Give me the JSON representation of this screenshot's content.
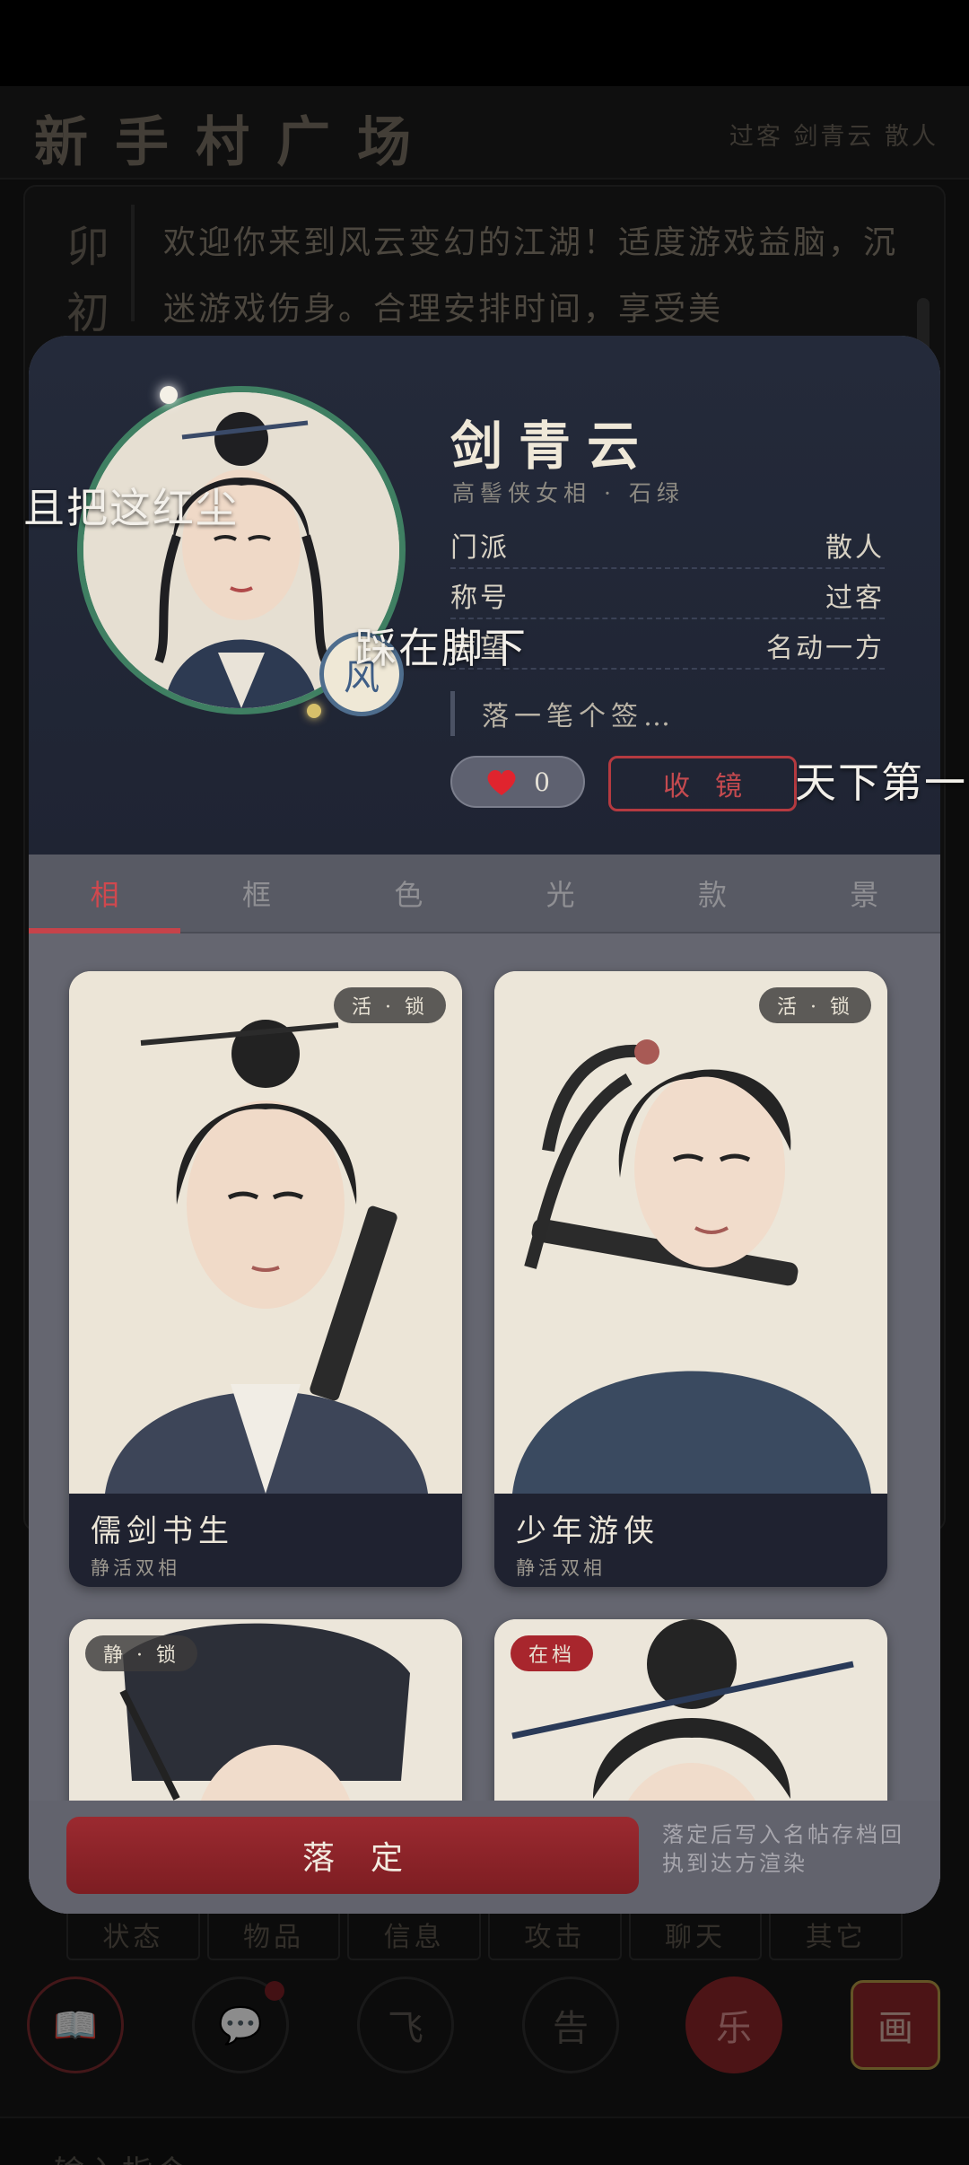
{
  "game": {
    "title": "新手村广场",
    "user_info": "过客 剑青云  散人",
    "notice_side": "卯初",
    "notice_text": "欢迎你来到风云变幻的江湖！适度游戏益脑，沉迷游戏伤身。合理安排时间，享受美",
    "commands": [
      "状态",
      "物品",
      "信息",
      "攻击",
      "聊天",
      "其它"
    ],
    "bottom_buttons": [
      {
        "icon": "book-icon",
        "glyph": "📖"
      },
      {
        "icon": "chat-icon",
        "glyph": "💬"
      },
      {
        "icon": "fly-icon",
        "glyph": "飞"
      },
      {
        "icon": "announce-icon",
        "glyph": "告"
      },
      {
        "icon": "music-icon",
        "glyph": "乐"
      },
      {
        "icon": "painting-icon",
        "glyph": "画"
      }
    ],
    "input_placeholder": "输入指令"
  },
  "profile": {
    "name": "剑青云",
    "subtitle": "高髻侠女相  ·  石绿",
    "wind_badge": "风",
    "rows": [
      {
        "key": "门派",
        "value": "散人"
      },
      {
        "key": "称号",
        "value": "过客"
      },
      {
        "key": "声望",
        "value": "名动一方"
      }
    ],
    "signature": "落一笔个签…",
    "likes": "0",
    "collect_label": "收镜"
  },
  "floating_texts": [
    "且把这红尘",
    "踩在脚下",
    "天下第一"
  ],
  "tabs": [
    "相",
    "框",
    "色",
    "光",
    "款",
    "景"
  ],
  "active_tab": 0,
  "cards": [
    {
      "name": "儒剑书生",
      "sub": "静活双相",
      "badge": "活 · 锁"
    },
    {
      "name": "少年游侠",
      "sub": "静活双相",
      "badge": "活 · 锁"
    },
    {
      "name": "",
      "sub": "",
      "badge": "静 · 锁"
    },
    {
      "name": "",
      "sub": "",
      "badge": "在档"
    }
  ],
  "confirm": {
    "label": "落定",
    "note": "落定后写入名帖存档回执到达方渲染"
  },
  "colors": {
    "accent_red": "#c6434a",
    "ring_green": "#3f7f62",
    "panel_navy": "#242a3a"
  }
}
